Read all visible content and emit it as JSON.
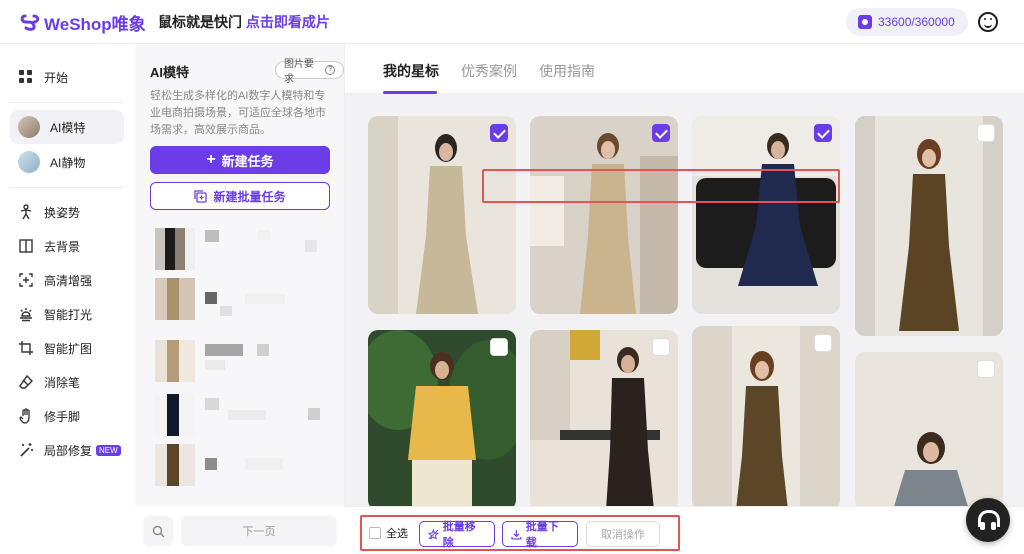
{
  "header": {
    "brand": "WeShop唯象",
    "slogan_part1": "鼠标就是快门",
    "slogan_part2": "点击即看成片",
    "credits": "33600/360000"
  },
  "sidebar": {
    "items": [
      {
        "label": "开始",
        "icon": "grid-icon"
      },
      {
        "label": "AI模特",
        "icon": "model-thumb",
        "active": true
      },
      {
        "label": "AI静物",
        "icon": "still-thumb"
      },
      {
        "label": "换姿势",
        "icon": "pose-icon"
      },
      {
        "label": "去背景",
        "icon": "remove-bg-icon"
      },
      {
        "label": "高清增强",
        "icon": "enhance-icon"
      },
      {
        "label": "智能打光",
        "icon": "lighting-icon"
      },
      {
        "label": "智能扩图",
        "icon": "expand-icon"
      },
      {
        "label": "消除笔",
        "icon": "eraser-icon"
      },
      {
        "label": "修手脚",
        "icon": "hand-icon"
      },
      {
        "label": "局部修复",
        "icon": "magic-wand-icon",
        "badge": "NEW"
      }
    ]
  },
  "panel": {
    "title": "AI模特",
    "req_label": "图片要求",
    "description": "轻松生成多样化的AI数字人模特和专业电商拍摄场景，可适应全球各地市场需求，高效展示商品。",
    "new_task": "新建任务",
    "new_batch_task": "新建批量任务",
    "next_page": "下一页"
  },
  "tabs": [
    {
      "label": "我的星标",
      "active": true
    },
    {
      "label": "优秀案例",
      "active": false
    },
    {
      "label": "使用指南",
      "active": false
    }
  ],
  "gallery": {
    "images": [
      {
        "id": 1,
        "checked": true,
        "dress": "#c8b89a"
      },
      {
        "id": 2,
        "checked": true,
        "dress": "#c9b48e"
      },
      {
        "id": 3,
        "checked": true,
        "dress": "#1f2a4e"
      },
      {
        "id": 4,
        "checked": false,
        "dress": "#5a4424"
      },
      {
        "id": 5,
        "checked": false,
        "dress": "#e6b94a"
      },
      {
        "id": 6,
        "checked": false,
        "dress": "#2a231d"
      },
      {
        "id": 7,
        "checked": false,
        "dress": "#5b4627"
      },
      {
        "id": 8,
        "checked": false,
        "dress": "#7d858c"
      }
    ]
  },
  "bottom_bar": {
    "select_all": "全选",
    "batch_remove": "批量移除",
    "batch_download": "批量下载",
    "cancel": "取消操作"
  },
  "colors": {
    "accent": "#6a3de8",
    "highlight": "#e05656"
  }
}
